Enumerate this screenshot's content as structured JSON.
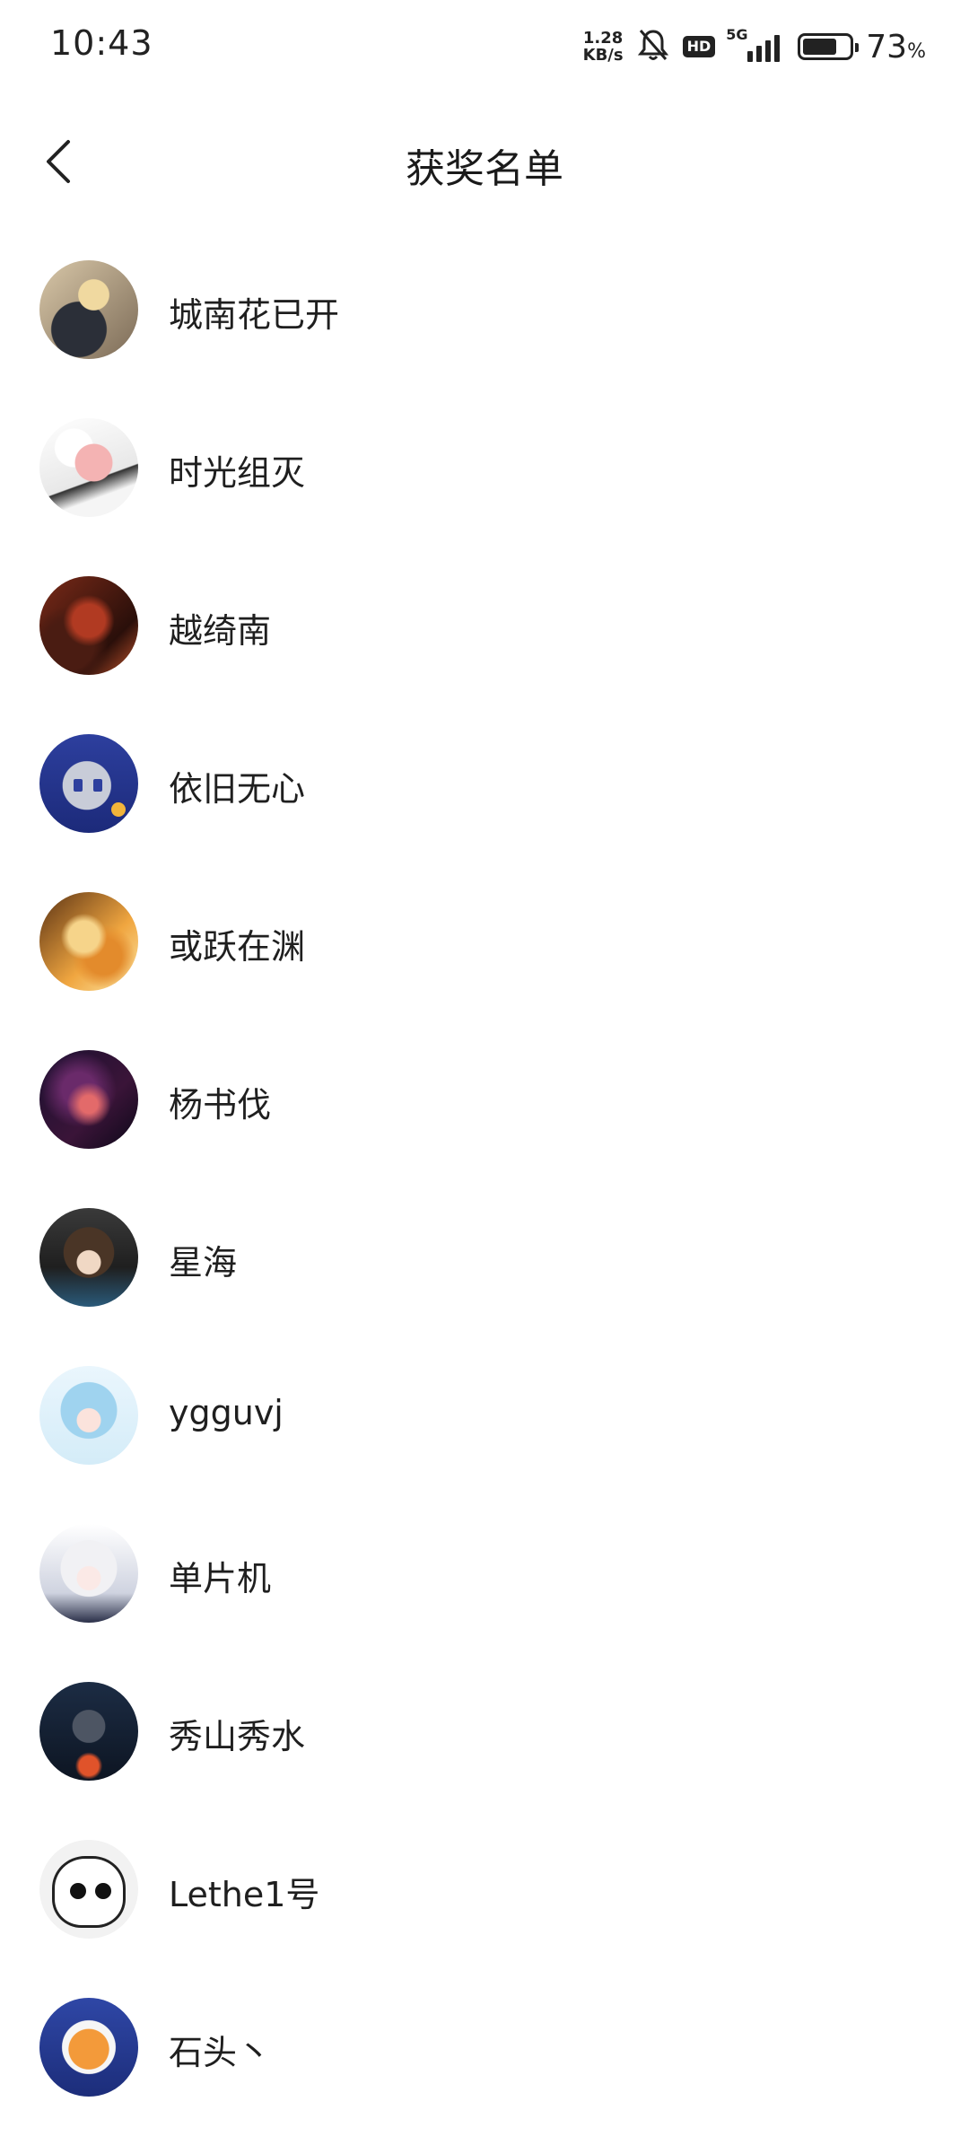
{
  "status_bar": {
    "time": "10:43",
    "net_speed_value": "1.28",
    "net_speed_unit": "KB/s",
    "hd_label": "HD",
    "network_label": "5G",
    "battery_level": 0.73,
    "battery_percent": "73",
    "battery_percent_sign": "%"
  },
  "header": {
    "title": "获奖名单",
    "back_icon": "chevron-left-icon"
  },
  "winners": [
    {
      "name": "城南花已开"
    },
    {
      "name": "时光组灭"
    },
    {
      "name": "越绮南"
    },
    {
      "name": "依旧无心"
    },
    {
      "name": "或跃在渊"
    },
    {
      "name": "杨书伐"
    },
    {
      "name": "星海"
    },
    {
      "name": "ygguvj"
    },
    {
      "name": "单片机"
    },
    {
      "name": "秀山秀水"
    },
    {
      "name": "Lethe1号"
    },
    {
      "name": "石头丶"
    }
  ]
}
